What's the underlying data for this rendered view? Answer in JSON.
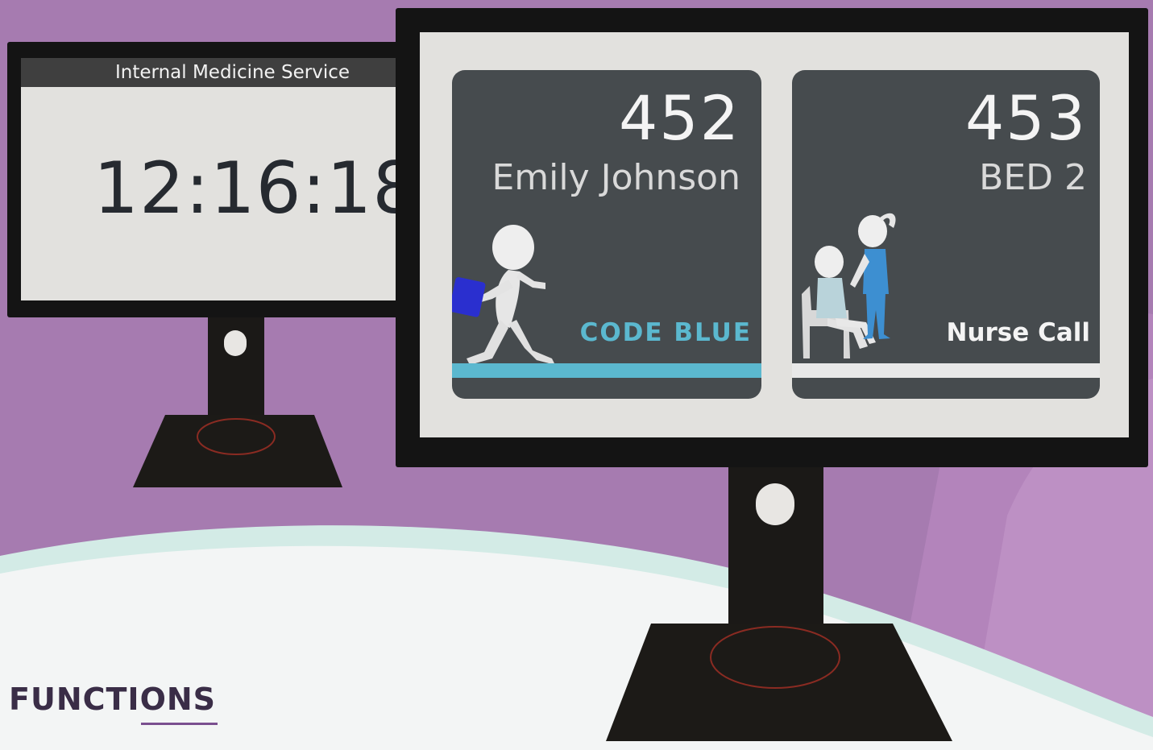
{
  "colors": {
    "background": "#a67bb0",
    "code_blue": "#5bb8cf",
    "card": "#464b4e",
    "screen": "#e2e1de",
    "bezel": "#141414"
  },
  "left_monitor": {
    "header": "Internal Medicine Service",
    "clock": "12:16:18"
  },
  "right_monitor": {
    "cards": [
      {
        "room": "452",
        "subtitle": "Emily Johnson",
        "alert": "CODE BLUE",
        "alert_color": "#5bb8cf",
        "bar_color": "#5bb8cf",
        "icon": "running-figure-icon"
      },
      {
        "room": "453",
        "subtitle": "BED 2",
        "alert": "Nurse Call",
        "alert_color": "#f4f4f4",
        "bar_color": "#e8e8e8",
        "icon": "nurse-patient-icon"
      }
    ]
  },
  "footer": {
    "section_title": "FUNCTIONS"
  }
}
